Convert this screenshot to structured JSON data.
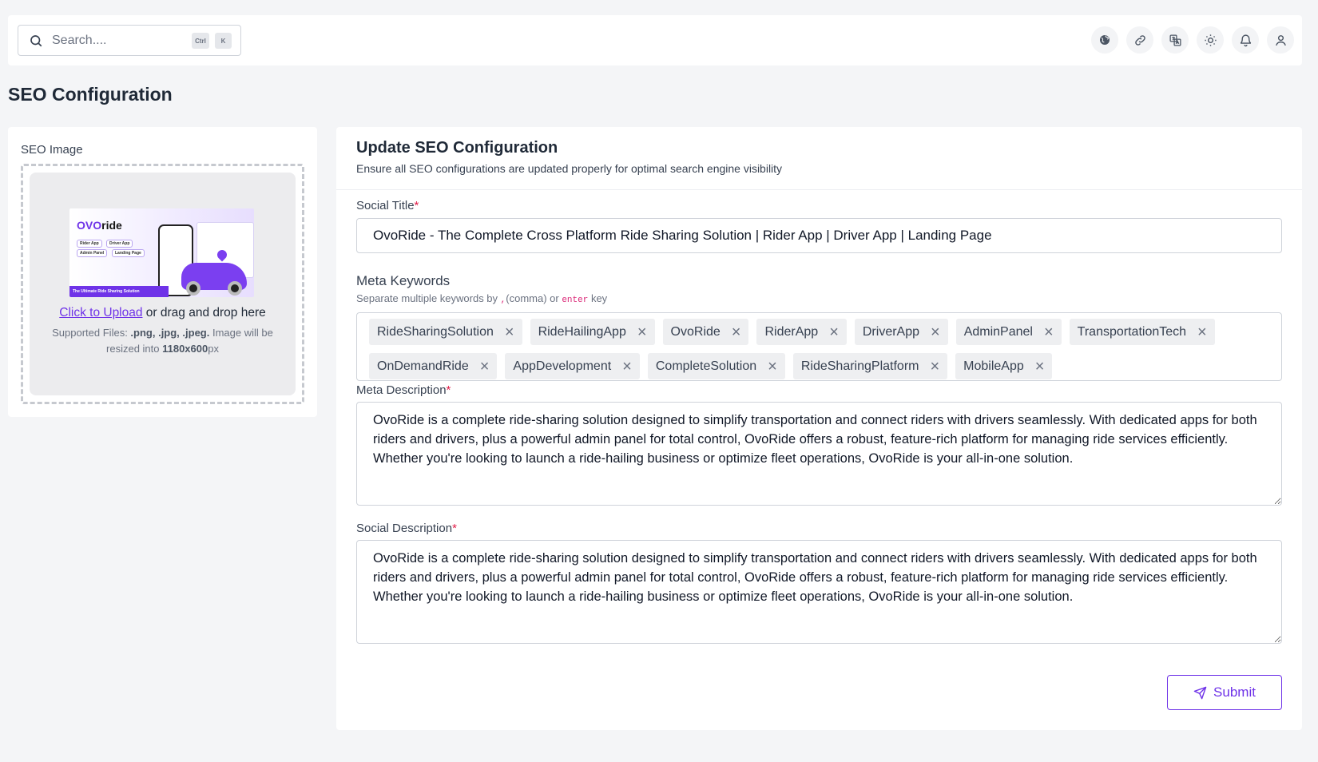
{
  "topbar": {
    "search": {
      "placeholder": "Search....",
      "kbd_ctrl": "Ctrl",
      "kbd_k": "K"
    },
    "icons": [
      "globe-icon",
      "link-icon",
      "translate-icon",
      "sun-icon",
      "bell-icon",
      "user-icon"
    ]
  },
  "page": {
    "title": "SEO Configuration"
  },
  "seo_image": {
    "label": "SEO Image",
    "upload_link": "Click to Upload",
    "upload_text": " or drag and drop here",
    "hint_prefix": "Supported Files: ",
    "hint_types": ".png, .jpg, .jpeg.",
    "hint_mid": " Image will be resized into ",
    "hint_size": "1180x600",
    "hint_unit": "px",
    "preview": {
      "brand_prefix": "OVO",
      "brand_suffix": "ride",
      "pills": [
        "Rider App",
        "Driver App",
        "Admin Panel",
        "Landing Page"
      ],
      "tagline": "The Ultimate Ride Sharing Solution"
    }
  },
  "form": {
    "title": "Update SEO Configuration",
    "subtitle": "Ensure all SEO configurations are updated properly for optimal search engine visibility",
    "social_title": {
      "label": "Social Title",
      "required": "*",
      "value": "OvoRide - The Complete Cross Platform Ride Sharing Solution | Rider App | Driver App | Landing Page"
    },
    "meta_keywords": {
      "label": "Meta Keywords",
      "hint_prefix": "Separate multiple keywords by ",
      "hint_comma": ",",
      "hint_mid": "(comma) or ",
      "hint_enter": "enter",
      "hint_suffix": " key",
      "tags": [
        "RideSharingSolution",
        "RideHailingApp",
        "OvoRide",
        "RiderApp",
        "DriverApp",
        "AdminPanel",
        "TransportationTech",
        "OnDemandRide",
        "AppDevelopment",
        "CompleteSolution",
        "RideSharingPlatform",
        "MobileApp"
      ]
    },
    "meta_description": {
      "label": "Meta Description",
      "required": "*",
      "value": "OvoRide is a complete ride-sharing solution designed to simplify transportation and connect riders with drivers seamlessly. With dedicated apps for both riders and drivers, plus a powerful admin panel for total control, OvoRide offers a robust, feature-rich platform for managing ride services efficiently. Whether you're looking to launch a ride-hailing business or optimize fleet operations, OvoRide is your all-in-one solution."
    },
    "social_description": {
      "label": "Social Description",
      "required": "*",
      "value": "OvoRide is a complete ride-sharing solution designed to simplify transportation and connect riders with drivers seamlessly. With dedicated apps for both riders and drivers, plus a powerful admin panel for total control, OvoRide offers a robust, feature-rich platform for managing ride services efficiently. Whether you're looking to launch a ride-hailing business or optimize fleet operations, OvoRide is your all-in-one solution."
    },
    "submit_label": "Submit"
  },
  "colors": {
    "accent": "#6f33e8",
    "required": "#e11d48",
    "background": "#f4f5f7"
  }
}
